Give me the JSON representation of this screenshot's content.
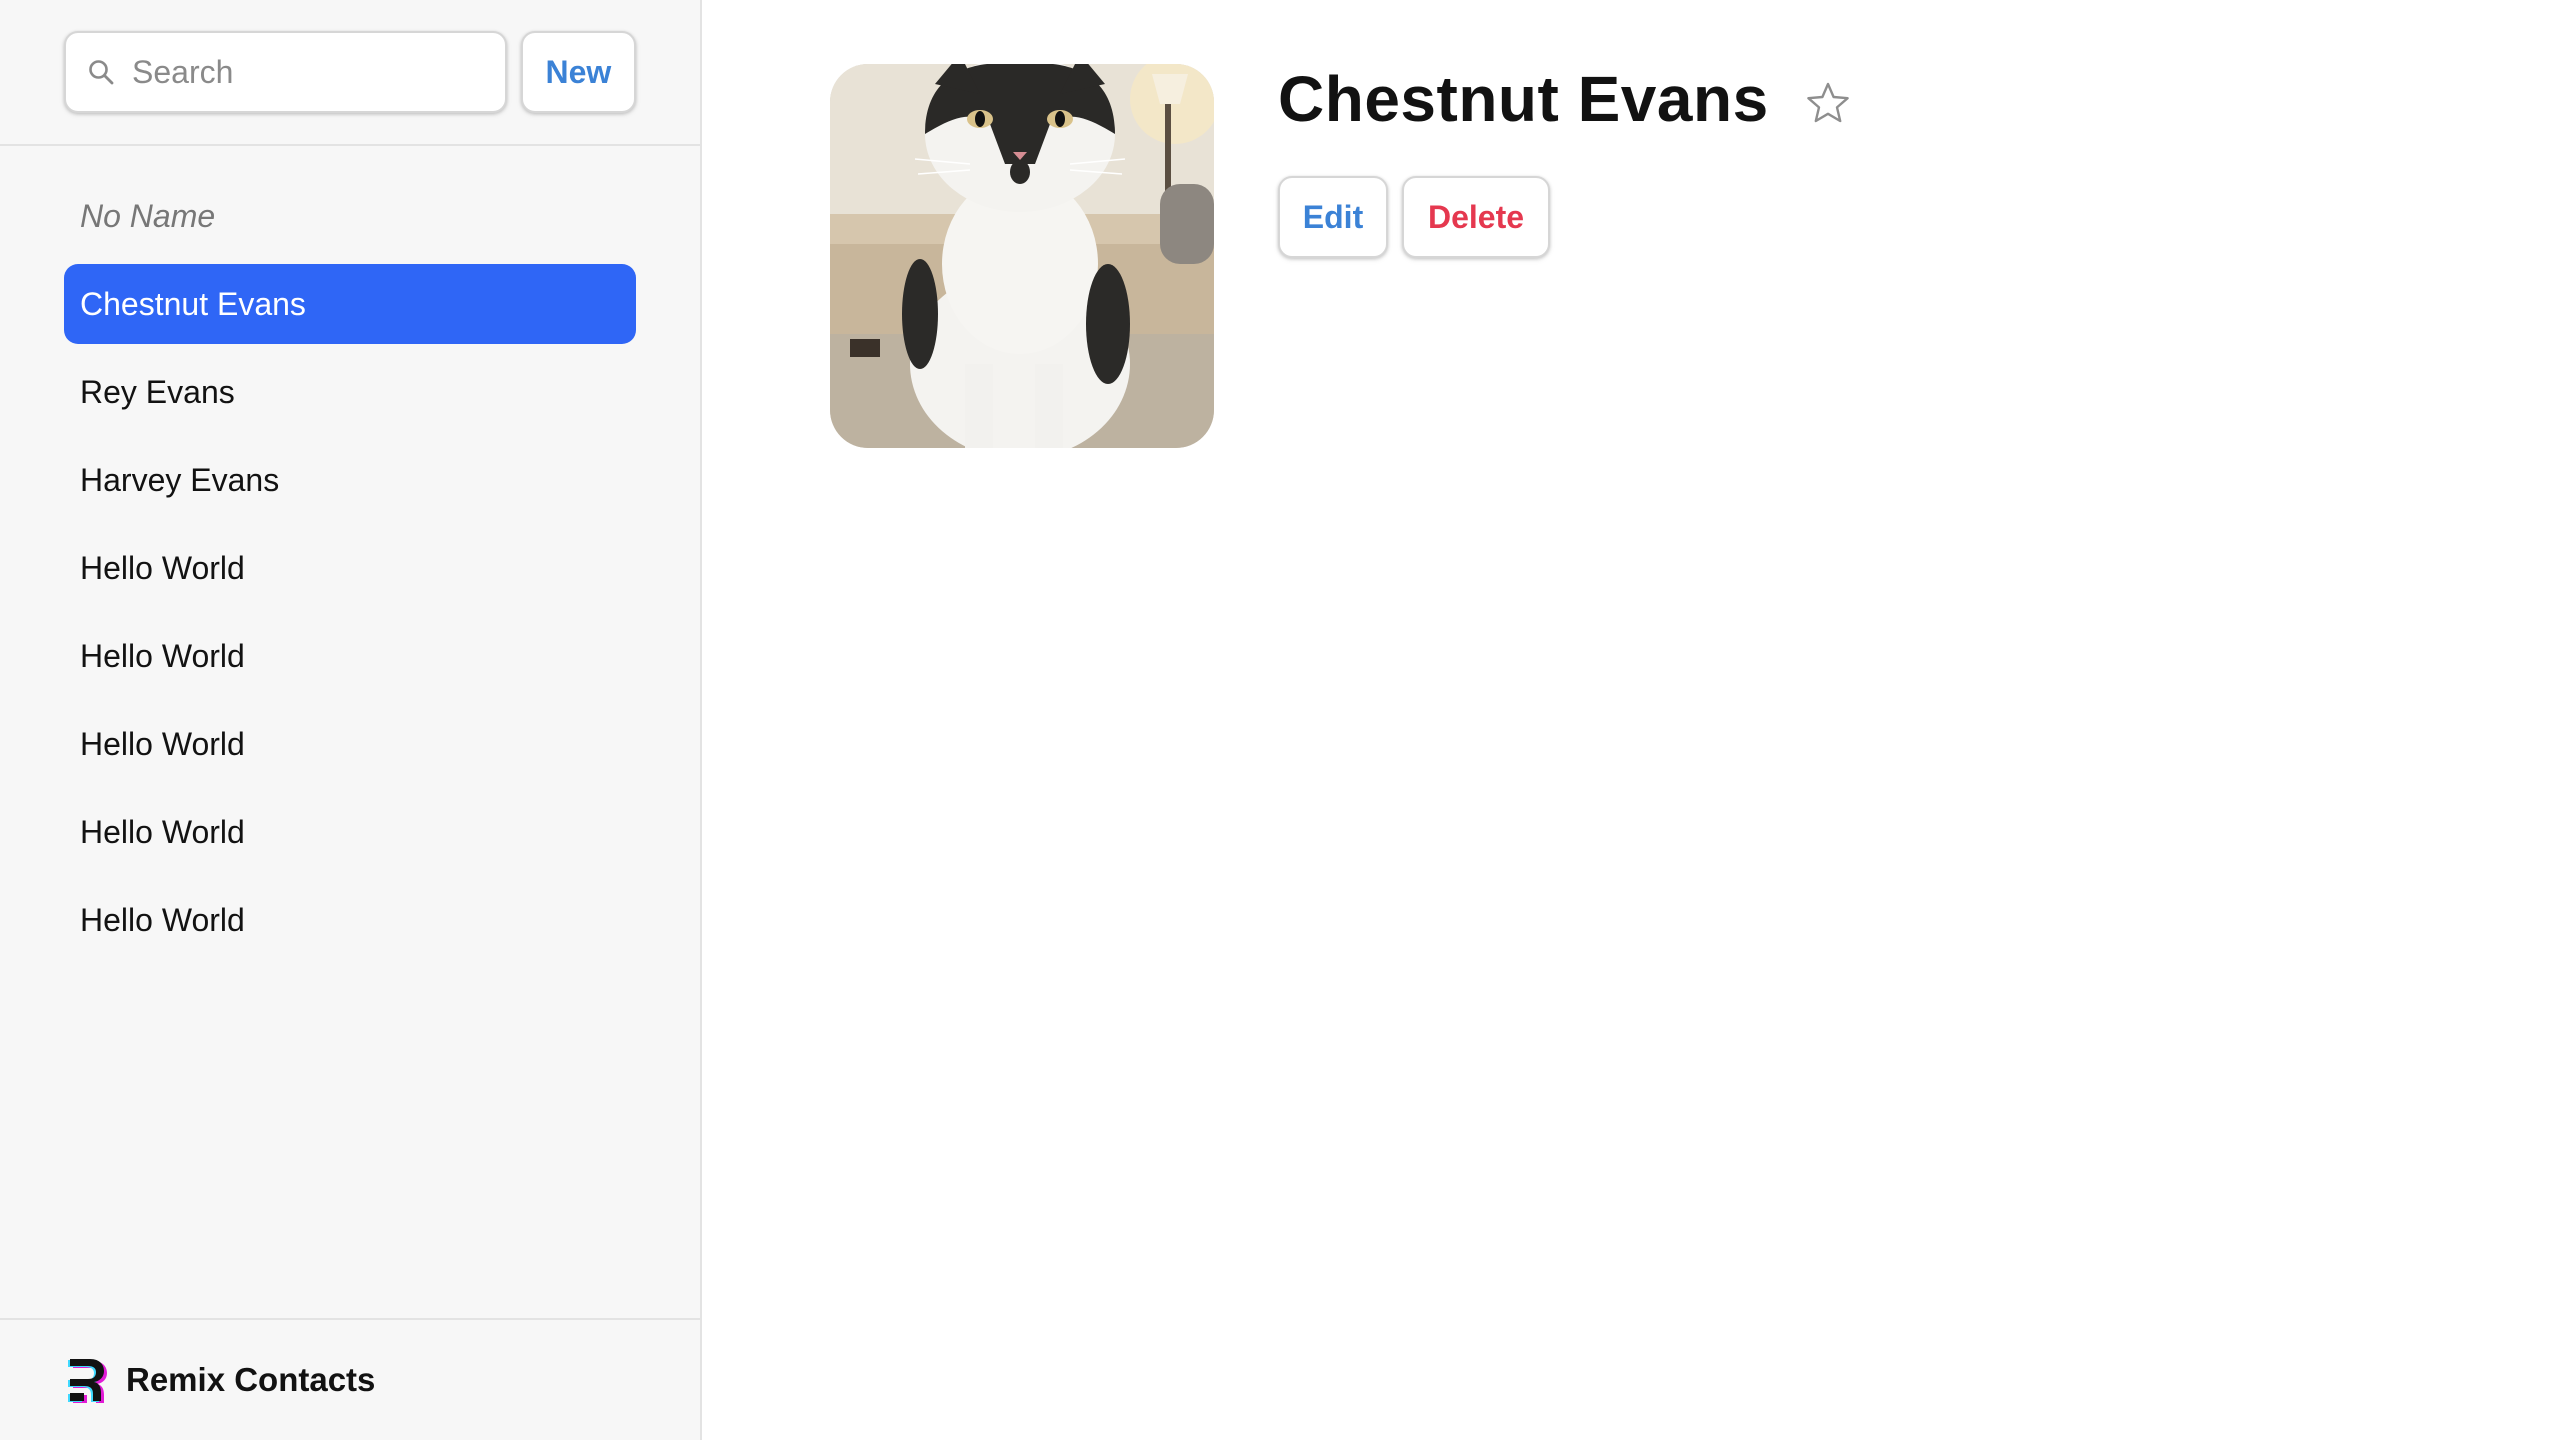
{
  "sidebar": {
    "search": {
      "placeholder": "Search",
      "value": ""
    },
    "new_label": "New",
    "contacts": [
      {
        "label": "No Name",
        "empty": true,
        "active": false
      },
      {
        "label": "Chestnut Evans",
        "empty": false,
        "active": true
      },
      {
        "label": "Rey Evans",
        "empty": false,
        "active": false
      },
      {
        "label": "Harvey Evans",
        "empty": false,
        "active": false
      },
      {
        "label": "Hello World",
        "empty": false,
        "active": false
      },
      {
        "label": "Hello World",
        "empty": false,
        "active": false
      },
      {
        "label": "Hello World",
        "empty": false,
        "active": false
      },
      {
        "label": "Hello World",
        "empty": false,
        "active": false
      },
      {
        "label": "Hello World",
        "empty": false,
        "active": false
      }
    ],
    "footer": {
      "app_name": "Remix Contacts",
      "logo_icon": "remix-logo-icon"
    }
  },
  "detail": {
    "name": "Chestnut Evans",
    "favorite": false,
    "favorite_icon": "star-outline-icon",
    "avatar_icon": "cat-photo",
    "edit_label": "Edit",
    "delete_label": "Delete"
  },
  "colors": {
    "accent": "#2f66f6",
    "link_blue": "#3b82d6",
    "danger_red": "#e5384f",
    "sidebar_bg": "#f7f7f7"
  }
}
